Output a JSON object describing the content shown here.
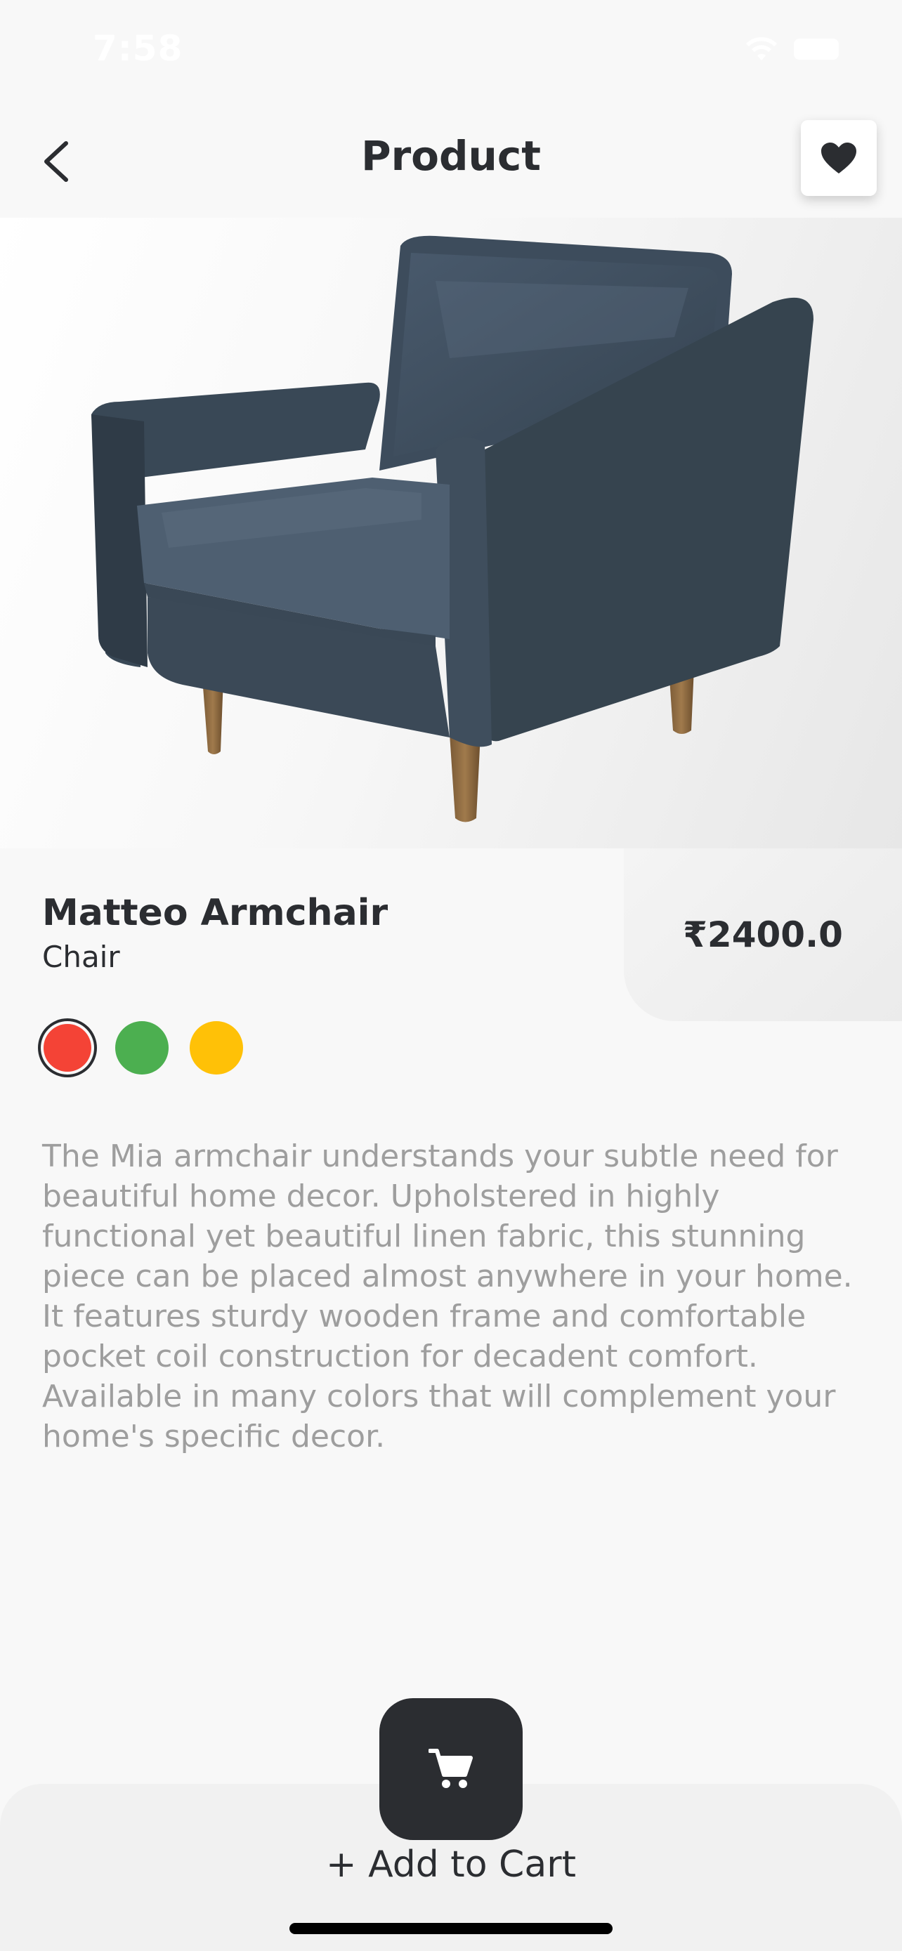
{
  "status_bar": {
    "time": "7:58"
  },
  "header": {
    "title": "Product",
    "back_icon": "chevron-left-icon",
    "favorite_icon": "heart-icon"
  },
  "product": {
    "name": "Matteo Armchair",
    "category": "Chair",
    "price": "₹2400.0",
    "image": "armchair-photo",
    "colors": [
      {
        "name": "red",
        "hex": "#f44336",
        "selected": true
      },
      {
        "name": "green",
        "hex": "#4caf50",
        "selected": false
      },
      {
        "name": "yellow",
        "hex": "#ffc107",
        "selected": false
      }
    ],
    "description": "The Mia armchair understands your subtle need for beautiful home decor. Upholstered in highly functional yet beautiful linen fabric, this stunning piece can be placed almost anywhere in your home. It features sturdy wooden frame and comfortable pocket coil construction for decadent comfort. Available in many colors that will complement your home's specific decor."
  },
  "cart": {
    "label": "+ Add to Cart",
    "icon": "cart-icon"
  },
  "colors": {
    "dark": "#2b2d31",
    "muted_text": "#9e9e9e",
    "background": "#f8f8f8"
  }
}
